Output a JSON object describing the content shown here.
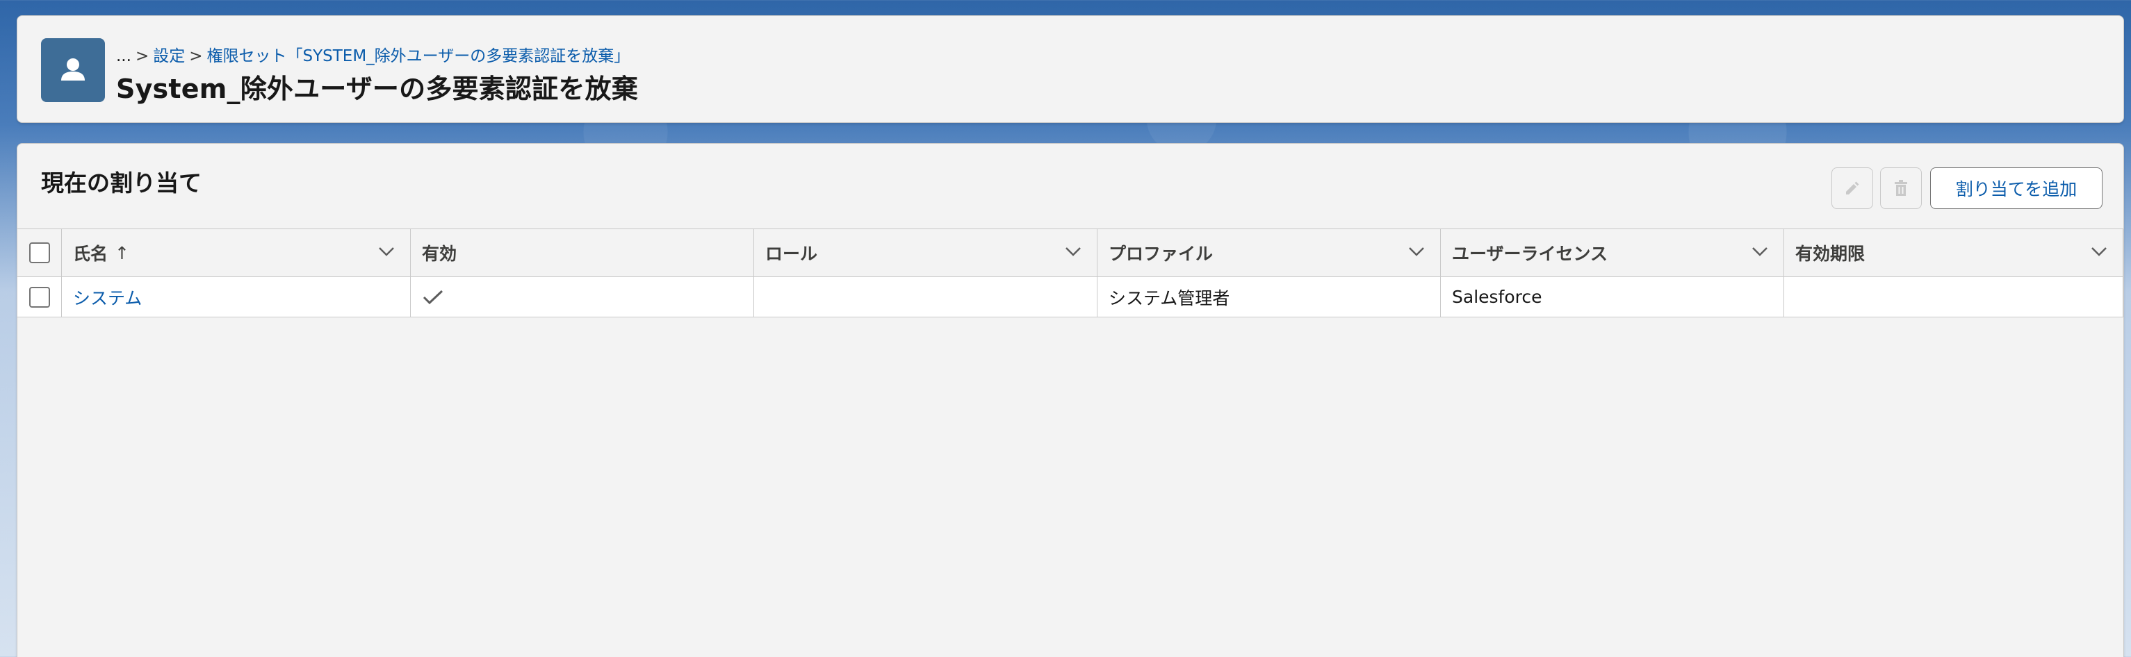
{
  "header": {
    "breadcrumb": {
      "ellipsis": "...",
      "separator": ">",
      "item1": "設定",
      "item2": "権限セット「SYSTEM_除外ユーザーの多要素認証を放棄」"
    },
    "title": "System_除外ユーザーの多要素認証を放棄"
  },
  "section": {
    "title": "現在の割り当て",
    "add_button_label": "割り当てを追加"
  },
  "table": {
    "columns": [
      "氏名",
      "有効",
      "ロール",
      "プロファイル",
      "ユーザーライセンス",
      "有効期限"
    ],
    "sort_indicator": "↑",
    "rows": [
      {
        "name": "システム",
        "active": true,
        "role": "",
        "profile": "システム管理者",
        "license": "Salesforce",
        "expiry": ""
      }
    ]
  },
  "icons": {
    "record": "user-icon",
    "edit": "pencil-icon",
    "delete": "trash-icon"
  },
  "colors": {
    "link": "#0b5cab",
    "record_icon_bg": "#3e6d97",
    "background_top": "#2f66a8"
  }
}
